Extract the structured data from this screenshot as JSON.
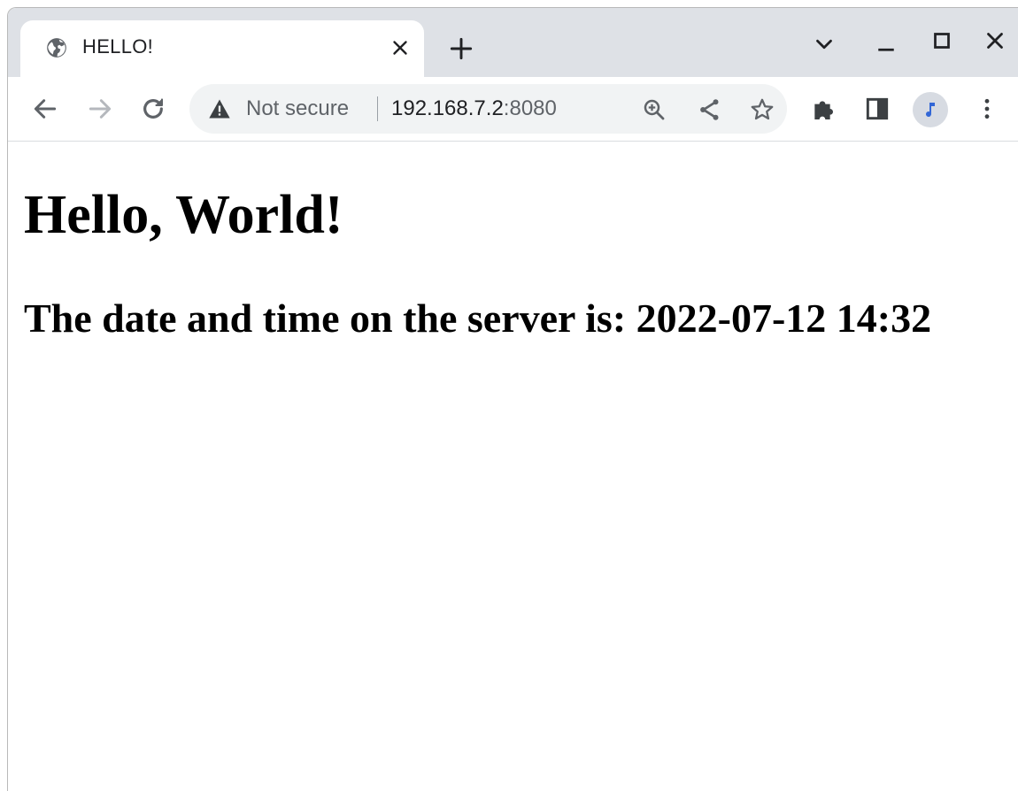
{
  "browser": {
    "tab": {
      "title": "HELLO!",
      "favicon": "globe-icon",
      "close_icon": "close-icon"
    },
    "new_tab_icon": "plus-icon",
    "window_controls": [
      "chevron-down-icon",
      "minimize-icon",
      "maximize-icon",
      "close-icon"
    ],
    "toolbar": {
      "back_icon": "arrow-left-icon",
      "forward_icon": "arrow-right-icon",
      "reload_icon": "reload-icon",
      "security_label": "Not secure",
      "security_icon": "warning-triangle-icon",
      "url_host": "192.168.7.2",
      "url_port": ":8080",
      "zoom_icon": "zoom-in-icon",
      "share_icon": "share-icon",
      "bookmark_icon": "star-icon",
      "extensions_icon": "puzzle-icon",
      "side_panel_icon": "side-panel-icon",
      "profile_icon": "avatar",
      "menu_icon": "more-vert-icon"
    }
  },
  "page": {
    "heading": "Hello, World!",
    "subheading": "The date and time on the server is: 2022-07-12 14:32"
  },
  "colors": {
    "tabstrip": "#dee1e6",
    "omnibox": "#f1f3f4",
    "icon": "#5f6368",
    "avatar_accent": "#3367d6"
  }
}
